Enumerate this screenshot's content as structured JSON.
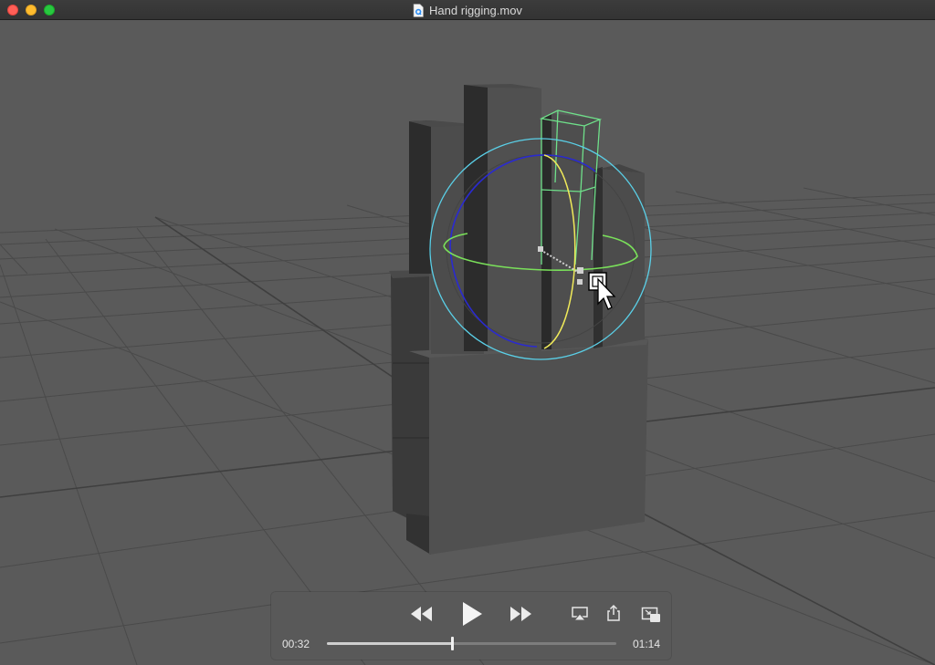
{
  "window": {
    "title": "Hand rigging.mov"
  },
  "player": {
    "current_time": "00:32",
    "duration": "01:14",
    "progress": 0.432
  },
  "icons": {
    "file": "quicktime-document-icon",
    "rewind": "rewind-icon",
    "play": "play-icon",
    "fast_forward": "fast-forward-icon",
    "airplay": "airplay-icon",
    "share": "share-icon",
    "pip": "picture-in-picture-icon",
    "cursor": "pointer-cursor-icon"
  },
  "colors": {
    "selection": "#6fe08a",
    "rotate_x": "#f0ea5a",
    "rotate_y": "#7ae05a",
    "rotate_z": "#2a2ad0",
    "rotate_outer": "#5ad0e8"
  }
}
